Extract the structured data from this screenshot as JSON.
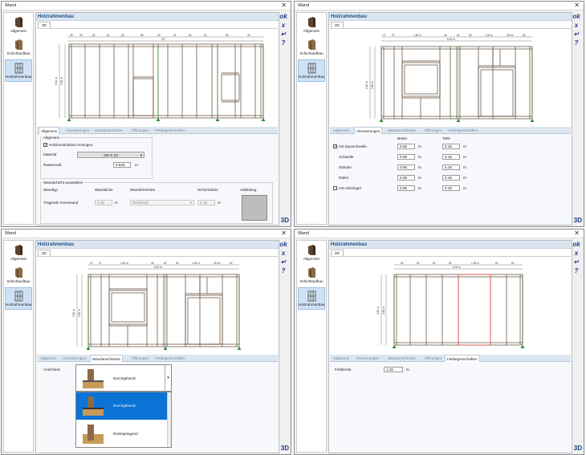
{
  "win1": {
    "title": "Wand",
    "close": "✕",
    "sidebar": [
      "Allgemein",
      "Schichtaufbau",
      "Holzrahmenbau"
    ],
    "section_title": "Holzrahmenbau",
    "view_tab": "2D",
    "tabs": [
      "Allgemein",
      "Abmessungen",
      "Wandanschlüsse",
      "Öffnungen",
      "Feldeigenschaften"
    ],
    "active_tab": "Allgemein",
    "right_toolbar": [
      "ok",
      "x",
      "↵",
      "?"
    ],
    "d3": "3D",
    "dims": {
      "top_segments": [
        "28 ",
        "30 ",
        "62 ",
        "62 ",
        "62 ",
        "96 ",
        "62 ",
        "62 ",
        "62 ",
        "62 ",
        "96 ",
        "32 "
      ],
      "overall": "4.9 ",
      "height1": "3.04 m",
      "height2": "2.96 m"
    },
    "panel": {
      "group_general": "Allgemein",
      "create_label": "Holzkonstruktion erzeugen",
      "material_label": "Material",
      "material_value": "NH S 10",
      "raster_label": "Rastermaß",
      "raster_value": "0.625",
      "unit": "m",
      "group_select": "Wandschicht auswählen",
      "col_headers": [
        "Wandtyp",
        "Wanddicke",
        "Wandschichten",
        "Schichtdicke",
        "Abbildung"
      ],
      "row_type": "Tragende Innenwand",
      "row_thickness": "0.15",
      "row_layer": "Brickwork",
      "row_layer_thickness": "0.15"
    }
  },
  "win2": {
    "title": "Wand",
    "close": "✕",
    "sidebar": [
      "Allgemein",
      "Schichtaufbau",
      "Holzrahmenbau"
    ],
    "section_title": "Holzrahmenbau",
    "view_tab": "2D",
    "tabs": [
      "Allgemein",
      "Abmessungen",
      "Wandanschlüsse",
      "Öffnungen",
      "Feldeigenschaften"
    ],
    "active_tab": "Abmessungen",
    "right_toolbar": [
      "ok",
      "x",
      "↵",
      "?"
    ],
    "d3": "3D",
    "dims": {
      "top_segments": [
        "37 ",
        "27 ",
        "1.60 m",
        "46 ",
        "62 ",
        "53 ",
        "1.09 m",
        "25 cm",
        "62 "
      ],
      "overall": "6.00 m",
      "height1": "2.62 m",
      "height2": "2.80 m"
    },
    "panel": {
      "col_width": "Breite",
      "col_depth": "Tiefe",
      "unit": "m",
      "rows": [
        {
          "label": "mit Spurschwelle",
          "checkbox": true,
          "checked": true,
          "width": "0.06",
          "depth": "0.16"
        },
        {
          "label": "Schwelle",
          "checkbox": false,
          "width": "0.06",
          "depth": "0.16"
        },
        {
          "label": "Ständer",
          "checkbox": false,
          "width": "0.06",
          "depth": "0.16"
        },
        {
          "label": "Rähm",
          "checkbox": false,
          "width": "0.06",
          "depth": "0.16"
        },
        {
          "label": "mit Holzriegel",
          "checkbox": true,
          "checked": false,
          "width": "0.06",
          "depth": "0.16"
        }
      ]
    }
  },
  "win3": {
    "title": "Wand",
    "close": "✕",
    "sidebar": [
      "Allgemein",
      "Schichtaufbau",
      "Holzrahmenbau"
    ],
    "section_title": "Holzrahmenbau",
    "view_tab": "2D",
    "tabs": [
      "Allgemein",
      "Abmessungen",
      "Wandanschlüsse",
      "Öffnungen",
      "Feldeigenschaften"
    ],
    "active_tab": "Wandanschlüsse",
    "right_toolbar": [
      "ok",
      "x",
      "↵",
      "?"
    ],
    "d3": "3D",
    "dims": {
      "top_segments": [
        "37 ",
        "27 ",
        "1.60 m",
        "46 ",
        "62 ",
        "53 ",
        "1.09 m",
        "25 cm",
        "62 "
      ],
      "overall": "6.00 m",
      "height1": "2.62 m",
      "height2": "2.80 m"
    },
    "panel": {
      "label": "Anschluss",
      "selected": "Durchgehend",
      "options": [
        "Durchgehend",
        "Rückspringend"
      ]
    }
  },
  "win4": {
    "title": "Wand",
    "close": "✕",
    "sidebar": [
      "Allgemein",
      "Schichtaufbau",
      "Holzrahmenbau"
    ],
    "section_title": "Holzrahmenbau",
    "view_tab": "2D",
    "tabs": [
      "Allgemein",
      "Abmessungen",
      "Wandanschlüsse",
      "Öffnungen",
      "Feldeigenschaften"
    ],
    "active_tab": "Feldeigenschaften",
    "right_toolbar": [
      "ok",
      "x",
      "↵",
      "?"
    ],
    "d3": "3D",
    "dims": {
      "top_segments": [
        "62 ",
        "62 ",
        "62 ",
        "62 ",
        "1.25 m",
        "62 ",
        "62 "
      ],
      "overall": "6.00 m",
      "height1": "2.62 m",
      "height2": "2.80 m"
    },
    "panel": {
      "label": "Feldbreite",
      "value": "1.25",
      "unit": "m"
    }
  }
}
